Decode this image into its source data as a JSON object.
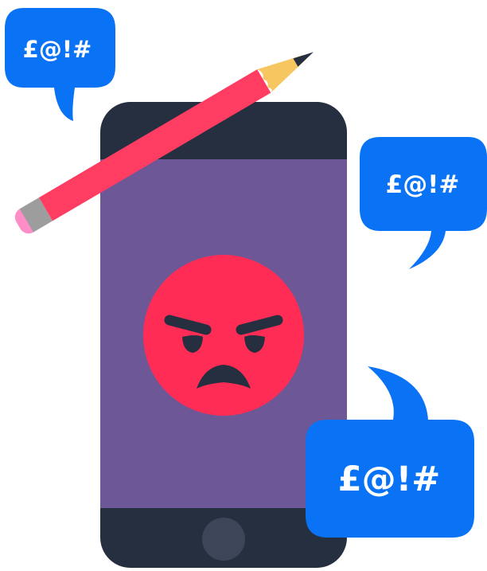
{
  "colors": {
    "bubble": "#0a73f5",
    "phone_body": "#252f40",
    "screen": "#6d5797",
    "home_button": "#3d4658",
    "emoji_face": "#ff2c55",
    "emoji_features": "#252f40",
    "pencil_body": "#ff3d63",
    "pencil_eraser": "#ff8ec8",
    "pencil_ferrule": "#9d9d9d",
    "pencil_wood": "#f6c761",
    "pencil_lead": "#252f40"
  },
  "icons": [
    "angry-face-icon",
    "pencil-icon",
    "speech-bubble-icon",
    "home-button-icon"
  ],
  "bubbles": {
    "top_left": {
      "text": "£@!#"
    },
    "right": {
      "text": "£@!#"
    },
    "bottom_right": {
      "text": "£@!#"
    }
  }
}
